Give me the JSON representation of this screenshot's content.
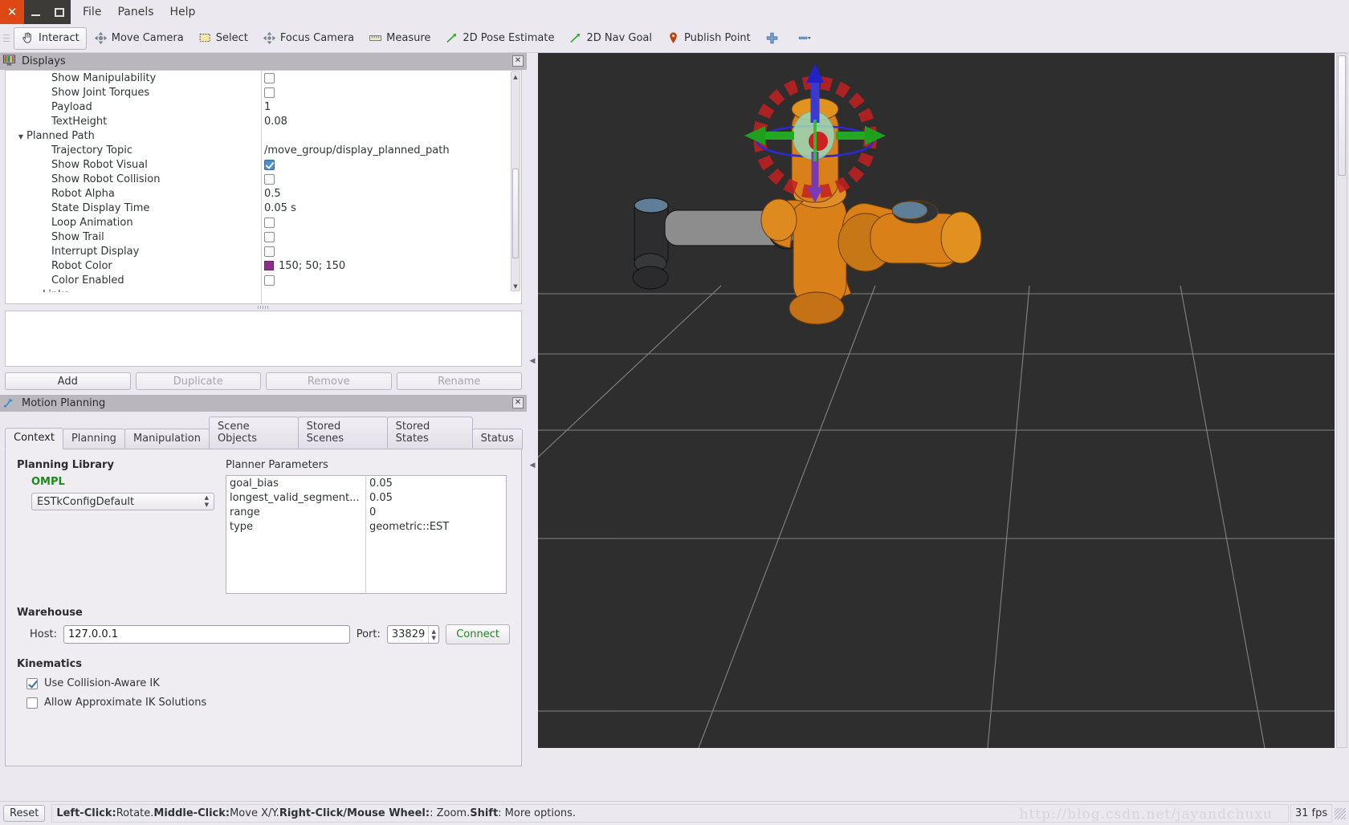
{
  "window": {
    "close_label": "✕",
    "minimize_label": "",
    "maximize_label": ""
  },
  "menubar": {
    "items": [
      "File",
      "Panels",
      "Help"
    ]
  },
  "toolbar": {
    "items": [
      {
        "label": "Interact",
        "icon": "hand-cursor-icon",
        "active": true
      },
      {
        "label": "Move Camera",
        "icon": "move-camera-icon",
        "active": false
      },
      {
        "label": "Select",
        "icon": "select-rectangle-icon",
        "active": false
      },
      {
        "label": "Focus Camera",
        "icon": "focus-camera-icon",
        "active": false
      },
      {
        "label": "Measure",
        "icon": "ruler-icon",
        "active": false
      },
      {
        "label": "2D Pose Estimate",
        "icon": "pose-arrow-icon",
        "active": false
      },
      {
        "label": "2D Nav Goal",
        "icon": "nav-goal-arrow-icon",
        "active": false
      },
      {
        "label": "Publish Point",
        "icon": "map-pin-icon",
        "active": false
      },
      {
        "label": "",
        "icon": "plus-cross-icon",
        "active": false
      },
      {
        "label": "",
        "icon": "minus-dropdown-icon",
        "active": false
      }
    ]
  },
  "displays_panel": {
    "title": "Displays",
    "close_label": "✕",
    "rows": [
      {
        "name": "Show Manipulability",
        "indent": "sub",
        "type": "checkbox",
        "value": false
      },
      {
        "name": "Show Joint Torques",
        "indent": "sub",
        "type": "checkbox",
        "value": false
      },
      {
        "name": "Payload",
        "indent": "sub",
        "type": "text",
        "value": "1"
      },
      {
        "name": "TextHeight",
        "indent": "sub",
        "type": "text",
        "value": "0.08"
      },
      {
        "name": "Planned Path",
        "indent": "group",
        "type": "group",
        "expanded": true,
        "value": ""
      },
      {
        "name": "Trajectory Topic",
        "indent": "sub",
        "type": "text",
        "value": "/move_group/display_planned_path"
      },
      {
        "name": "Show Robot Visual",
        "indent": "sub",
        "type": "checkbox",
        "value": true
      },
      {
        "name": "Show Robot Collision",
        "indent": "sub",
        "type": "checkbox",
        "value": false
      },
      {
        "name": "Robot Alpha",
        "indent": "sub",
        "type": "text",
        "value": "0.5"
      },
      {
        "name": "State Display Time",
        "indent": "sub",
        "type": "text",
        "value": "0.05 s"
      },
      {
        "name": "Loop Animation",
        "indent": "sub",
        "type": "checkbox",
        "value": false
      },
      {
        "name": "Show Trail",
        "indent": "sub",
        "type": "checkbox",
        "value": false
      },
      {
        "name": "Interrupt Display",
        "indent": "sub",
        "type": "checkbox",
        "value": false
      },
      {
        "name": "Robot Color",
        "indent": "sub",
        "type": "color",
        "value": "150; 50; 150",
        "color_hex": "#8f2a8f"
      },
      {
        "name": "Color Enabled",
        "indent": "sub",
        "type": "checkbox",
        "value": false
      },
      {
        "name": "Links",
        "indent": "subgroup",
        "type": "group",
        "expanded": false,
        "value": ""
      }
    ],
    "buttons": [
      {
        "label": "Add",
        "enabled": true
      },
      {
        "label": "Duplicate",
        "enabled": false
      },
      {
        "label": "Remove",
        "enabled": false
      },
      {
        "label": "Rename",
        "enabled": false
      }
    ]
  },
  "motion_planning": {
    "title": "Motion Planning",
    "close_label": "✕",
    "tabs": [
      {
        "label": "Context",
        "selected": true
      },
      {
        "label": "Planning",
        "selected": false
      },
      {
        "label": "Manipulation",
        "selected": false
      },
      {
        "label": "Scene Objects",
        "selected": false
      },
      {
        "label": "Stored Scenes",
        "selected": false
      },
      {
        "label": "Stored States",
        "selected": false
      },
      {
        "label": "Status",
        "selected": false
      }
    ],
    "planning_library": {
      "heading": "Planning Library",
      "library_name": "OMPL",
      "selected_planner": "ESTkConfigDefault"
    },
    "planner_parameters": {
      "heading": "Planner Parameters",
      "rows": [
        {
          "key": "goal_bias",
          "value": "0.05"
        },
        {
          "key": "longest_valid_segment...",
          "value": "0.05"
        },
        {
          "key": "range",
          "value": "0"
        },
        {
          "key": "type",
          "value": "geometric::EST"
        }
      ]
    },
    "warehouse": {
      "heading": "Warehouse",
      "host_label": "Host:",
      "host_value": "127.0.0.1",
      "port_label": "Port:",
      "port_value": "33829",
      "connect_label": "Connect"
    },
    "kinematics": {
      "heading": "Kinematics",
      "options": [
        {
          "label": "Use Collision-Aware IK",
          "checked": true
        },
        {
          "label": "Allow Approximate IK Solutions",
          "checked": false
        }
      ]
    }
  },
  "statusbar": {
    "reset_label": "Reset",
    "hint_parts": [
      {
        "text": "Left-Click:",
        "bold": true
      },
      {
        "text": " Rotate. ",
        "bold": false
      },
      {
        "text": "Middle-Click:",
        "bold": true
      },
      {
        "text": " Move X/Y. ",
        "bold": false
      },
      {
        "text": "Right-Click/Mouse Wheel:",
        "bold": true
      },
      {
        "text": ": Zoom. ",
        "bold": false
      },
      {
        "text": "Shift",
        "bold": true
      },
      {
        "text": ": More options.",
        "bold": false
      }
    ],
    "fps": "31 fps"
  },
  "viewport": {
    "watermark": "http://blog.csdn.net/jayandchuxu",
    "background_hex": "#2e2e2e",
    "grid_hex": "#9a9a9a",
    "robot_orange_hex": "#d98018",
    "robot_grey_hex": "#8e8e8e",
    "robot_blue_hex": "#5b7f9c",
    "marker_red_hex": "#cc2222",
    "marker_green_hex": "#22aa22",
    "marker_blue_hex": "#2222cc"
  }
}
